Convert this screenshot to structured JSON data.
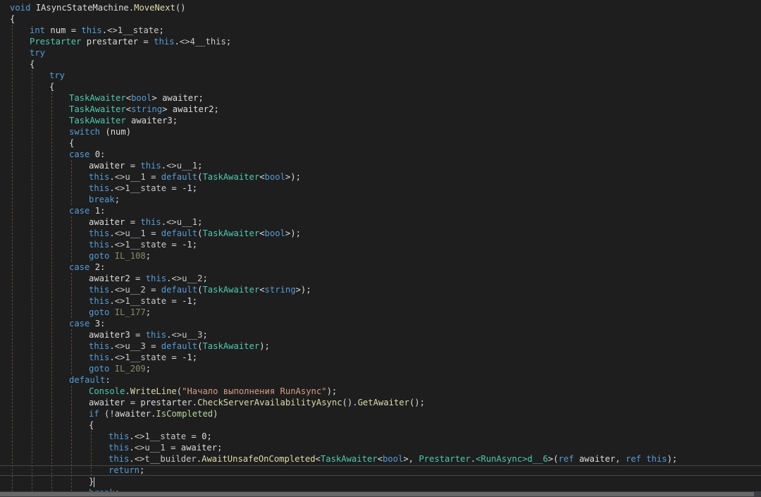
{
  "code": {
    "lines": [
      {
        "indent": 0,
        "tokens": [
          [
            "kw",
            "void"
          ],
          [
            "pl",
            " IAsyncStateMachine."
          ],
          [
            "mt",
            "MoveNext"
          ],
          [
            "pl",
            "()"
          ]
        ]
      },
      {
        "indent": 0,
        "tokens": [
          [
            "pl",
            "{"
          ]
        ]
      },
      {
        "indent": 1,
        "tokens": [
          [
            "kw",
            "int"
          ],
          [
            "pl",
            " num = "
          ],
          [
            "kw",
            "this"
          ],
          [
            "pl",
            "."
          ],
          [
            "mem",
            "<>1__state"
          ],
          [
            "pl",
            ";"
          ]
        ]
      },
      {
        "indent": 1,
        "tokens": [
          [
            "ty",
            "Prestarter"
          ],
          [
            "pl",
            " prestarter = "
          ],
          [
            "kw",
            "this"
          ],
          [
            "pl",
            "."
          ],
          [
            "mem",
            "<>4__this"
          ],
          [
            "pl",
            ";"
          ]
        ]
      },
      {
        "indent": 1,
        "tokens": [
          [
            "kw",
            "try"
          ]
        ]
      },
      {
        "indent": 1,
        "tokens": [
          [
            "pl",
            "{"
          ]
        ]
      },
      {
        "indent": 2,
        "tokens": [
          [
            "kw",
            "try"
          ]
        ]
      },
      {
        "indent": 2,
        "tokens": [
          [
            "pl",
            "{"
          ]
        ]
      },
      {
        "indent": 3,
        "tokens": [
          [
            "ty",
            "TaskAwaiter"
          ],
          [
            "pl",
            "<"
          ],
          [
            "kw",
            "bool"
          ],
          [
            "pl",
            "> awaiter;"
          ]
        ]
      },
      {
        "indent": 3,
        "tokens": [
          [
            "ty",
            "TaskAwaiter"
          ],
          [
            "pl",
            "<"
          ],
          [
            "kw",
            "string"
          ],
          [
            "pl",
            "> awaiter2;"
          ]
        ]
      },
      {
        "indent": 3,
        "tokens": [
          [
            "ty",
            "TaskAwaiter"
          ],
          [
            "pl",
            " awaiter3;"
          ]
        ]
      },
      {
        "indent": 3,
        "tokens": [
          [
            "kw",
            "switch"
          ],
          [
            "pl",
            " (num)"
          ]
        ]
      },
      {
        "indent": 3,
        "tokens": [
          [
            "pl",
            "{"
          ]
        ]
      },
      {
        "indent": 3,
        "tokens": [
          [
            "kw",
            "case"
          ],
          [
            "pl",
            " 0:"
          ]
        ]
      },
      {
        "indent": 4,
        "tokens": [
          [
            "pl",
            "awaiter = "
          ],
          [
            "kw",
            "this"
          ],
          [
            "pl",
            "."
          ],
          [
            "mem",
            "<>u__1"
          ],
          [
            "pl",
            ";"
          ]
        ]
      },
      {
        "indent": 4,
        "tokens": [
          [
            "kw",
            "this"
          ],
          [
            "pl",
            "."
          ],
          [
            "mem",
            "<>u__1"
          ],
          [
            "pl",
            " = "
          ],
          [
            "kw",
            "default"
          ],
          [
            "pl",
            "("
          ],
          [
            "ty",
            "TaskAwaiter"
          ],
          [
            "pl",
            "<"
          ],
          [
            "kw",
            "bool"
          ],
          [
            "pl",
            ">);"
          ]
        ]
      },
      {
        "indent": 4,
        "tokens": [
          [
            "kw",
            "this"
          ],
          [
            "pl",
            "."
          ],
          [
            "mem",
            "<>1__state"
          ],
          [
            "pl",
            " = -1;"
          ]
        ]
      },
      {
        "indent": 4,
        "tokens": [
          [
            "kw",
            "break"
          ],
          [
            "pl",
            ";"
          ]
        ]
      },
      {
        "indent": 3,
        "tokens": [
          [
            "kw",
            "case"
          ],
          [
            "pl",
            " 1:"
          ]
        ]
      },
      {
        "indent": 4,
        "tokens": [
          [
            "pl",
            "awaiter = "
          ],
          [
            "kw",
            "this"
          ],
          [
            "pl",
            "."
          ],
          [
            "mem",
            "<>u__1"
          ],
          [
            "pl",
            ";"
          ]
        ]
      },
      {
        "indent": 4,
        "tokens": [
          [
            "kw",
            "this"
          ],
          [
            "pl",
            "."
          ],
          [
            "mem",
            "<>u__1"
          ],
          [
            "pl",
            " = "
          ],
          [
            "kw",
            "default"
          ],
          [
            "pl",
            "("
          ],
          [
            "ty",
            "TaskAwaiter"
          ],
          [
            "pl",
            "<"
          ],
          [
            "kw",
            "bool"
          ],
          [
            "pl",
            ">);"
          ]
        ]
      },
      {
        "indent": 4,
        "tokens": [
          [
            "kw",
            "this"
          ],
          [
            "pl",
            "."
          ],
          [
            "mem",
            "<>1__state"
          ],
          [
            "pl",
            " = -1;"
          ]
        ]
      },
      {
        "indent": 4,
        "tokens": [
          [
            "kw",
            "goto"
          ],
          [
            "pl",
            " "
          ],
          [
            "lb",
            "IL_108"
          ],
          [
            "pl",
            ";"
          ]
        ]
      },
      {
        "indent": 3,
        "tokens": [
          [
            "kw",
            "case"
          ],
          [
            "pl",
            " 2:"
          ]
        ]
      },
      {
        "indent": 4,
        "tokens": [
          [
            "pl",
            "awaiter2 = "
          ],
          [
            "kw",
            "this"
          ],
          [
            "pl",
            "."
          ],
          [
            "mem",
            "<>u__2"
          ],
          [
            "pl",
            ";"
          ]
        ]
      },
      {
        "indent": 4,
        "tokens": [
          [
            "kw",
            "this"
          ],
          [
            "pl",
            "."
          ],
          [
            "mem",
            "<>u__2"
          ],
          [
            "pl",
            " = "
          ],
          [
            "kw",
            "default"
          ],
          [
            "pl",
            "("
          ],
          [
            "ty",
            "TaskAwaiter"
          ],
          [
            "pl",
            "<"
          ],
          [
            "kw",
            "string"
          ],
          [
            "pl",
            ">);"
          ]
        ]
      },
      {
        "indent": 4,
        "tokens": [
          [
            "kw",
            "this"
          ],
          [
            "pl",
            "."
          ],
          [
            "mem",
            "<>1__state"
          ],
          [
            "pl",
            " = -1;"
          ]
        ]
      },
      {
        "indent": 4,
        "tokens": [
          [
            "kw",
            "goto"
          ],
          [
            "pl",
            " "
          ],
          [
            "lb",
            "IL_177"
          ],
          [
            "pl",
            ";"
          ]
        ]
      },
      {
        "indent": 3,
        "tokens": [
          [
            "kw",
            "case"
          ],
          [
            "pl",
            " 3:"
          ]
        ]
      },
      {
        "indent": 4,
        "tokens": [
          [
            "pl",
            "awaiter3 = "
          ],
          [
            "kw",
            "this"
          ],
          [
            "pl",
            "."
          ],
          [
            "mem",
            "<>u__3"
          ],
          [
            "pl",
            ";"
          ]
        ]
      },
      {
        "indent": 4,
        "tokens": [
          [
            "kw",
            "this"
          ],
          [
            "pl",
            "."
          ],
          [
            "mem",
            "<>u__3"
          ],
          [
            "pl",
            " = "
          ],
          [
            "kw",
            "default"
          ],
          [
            "pl",
            "("
          ],
          [
            "ty",
            "TaskAwaiter"
          ],
          [
            "pl",
            ");"
          ]
        ]
      },
      {
        "indent": 4,
        "tokens": [
          [
            "kw",
            "this"
          ],
          [
            "pl",
            "."
          ],
          [
            "mem",
            "<>1__state"
          ],
          [
            "pl",
            " = -1;"
          ]
        ]
      },
      {
        "indent": 4,
        "tokens": [
          [
            "kw",
            "goto"
          ],
          [
            "pl",
            " "
          ],
          [
            "lb",
            "IL_209"
          ],
          [
            "pl",
            ";"
          ]
        ]
      },
      {
        "indent": 3,
        "tokens": [
          [
            "kw",
            "default"
          ],
          [
            "pl",
            ":"
          ]
        ]
      },
      {
        "indent": 4,
        "tokens": [
          [
            "ty",
            "Console"
          ],
          [
            "pl",
            "."
          ],
          [
            "mt",
            "WriteLine"
          ],
          [
            "pl",
            "("
          ],
          [
            "st",
            "\"Начало выполнения RunAsync\""
          ],
          [
            "pl",
            ");"
          ]
        ]
      },
      {
        "indent": 4,
        "tokens": [
          [
            "pl",
            "awaiter = prestarter."
          ],
          [
            "mt",
            "CheckServerAvailabilityAsync"
          ],
          [
            "pl",
            "()."
          ],
          [
            "mt",
            "GetAwaiter"
          ],
          [
            "pl",
            "();"
          ]
        ]
      },
      {
        "indent": 4,
        "tokens": [
          [
            "kw",
            "if"
          ],
          [
            "pl",
            " (!awaiter."
          ],
          [
            "fld",
            "IsCompleted"
          ],
          [
            "pl",
            ")"
          ]
        ]
      },
      {
        "indent": 4,
        "tokens": [
          [
            "pl",
            "{"
          ]
        ]
      },
      {
        "indent": 5,
        "tokens": [
          [
            "kw",
            "this"
          ],
          [
            "pl",
            "."
          ],
          [
            "mem",
            "<>1__state"
          ],
          [
            "pl",
            " = 0;"
          ]
        ]
      },
      {
        "indent": 5,
        "tokens": [
          [
            "kw",
            "this"
          ],
          [
            "pl",
            "."
          ],
          [
            "mem",
            "<>u__1"
          ],
          [
            "pl",
            " = awaiter;"
          ]
        ]
      },
      {
        "indent": 5,
        "tokens": [
          [
            "kw",
            "this"
          ],
          [
            "pl",
            "."
          ],
          [
            "mem",
            "<>t__builder"
          ],
          [
            "pl",
            "."
          ],
          [
            "mt",
            "AwaitUnsafeOnCompleted"
          ],
          [
            "pl",
            "<"
          ],
          [
            "ty",
            "TaskAwaiter"
          ],
          [
            "pl",
            "<"
          ],
          [
            "kw",
            "bool"
          ],
          [
            "pl",
            ">, "
          ],
          [
            "ty",
            "Prestarter"
          ],
          [
            "pl",
            "."
          ],
          [
            "ty",
            "<RunAsync>d__6"
          ],
          [
            "pl",
            ">("
          ],
          [
            "kw",
            "ref"
          ],
          [
            "pl",
            " awaiter, "
          ],
          [
            "kw",
            "ref"
          ],
          [
            "pl",
            " "
          ],
          [
            "kw",
            "this"
          ],
          [
            "pl",
            ");"
          ]
        ]
      },
      {
        "indent": 5,
        "tokens": [
          [
            "kw",
            "return"
          ],
          [
            "pl",
            ";"
          ]
        ]
      },
      {
        "indent": 4,
        "caret": true,
        "tokens": [
          [
            "pl",
            "}"
          ]
        ]
      },
      {
        "indent": 4,
        "tokens": [
          [
            "kw",
            "break"
          ],
          [
            "pl",
            ";"
          ]
        ]
      },
      {
        "indent": 3,
        "tokens": [
          [
            "pl",
            "}"
          ]
        ]
      }
    ]
  }
}
